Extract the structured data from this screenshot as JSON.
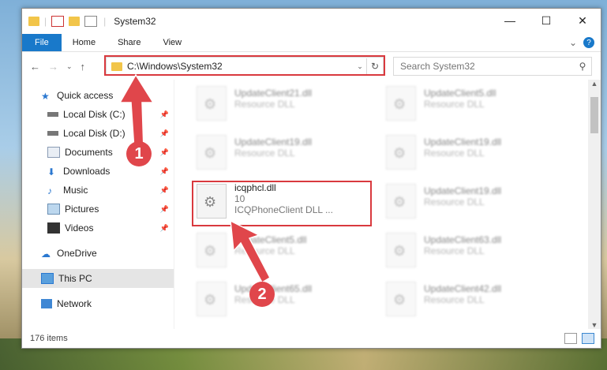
{
  "window": {
    "title": "System32",
    "controls": {
      "minimize": "—",
      "maximize": "☐",
      "close": "✕"
    }
  },
  "ribbon": {
    "tabs": [
      "File",
      "Home",
      "Share",
      "View"
    ],
    "expand": "⌄",
    "help": "?"
  },
  "address": {
    "path": "C:\\Windows\\System32",
    "dropdown": "⌄",
    "refresh": "↻"
  },
  "search": {
    "placeholder": "Search System32",
    "icon": "⚲"
  },
  "nav_buttons": {
    "back": "←",
    "forward": "→",
    "recent": "⌄",
    "up": "↑"
  },
  "sidebar": {
    "items": [
      {
        "label": "Quick access",
        "icon": "star-icon"
      },
      {
        "label": "Local Disk (C:)",
        "icon": "drive-icon",
        "pinned": true
      },
      {
        "label": "Local Disk (D:)",
        "icon": "drive-icon",
        "pinned": true
      },
      {
        "label": "Documents",
        "icon": "documents-icon",
        "pinned": true
      },
      {
        "label": "Downloads",
        "icon": "downloads-icon",
        "pinned": true
      },
      {
        "label": "Music",
        "icon": "music-icon",
        "pinned": true
      },
      {
        "label": "Pictures",
        "icon": "pictures-icon",
        "pinned": true
      },
      {
        "label": "Videos",
        "icon": "videos-icon",
        "pinned": true
      },
      {
        "label": "OneDrive",
        "icon": "cloud-icon"
      },
      {
        "label": "This PC",
        "icon": "computer-icon",
        "selected": true
      },
      {
        "label": "Network",
        "icon": "network-icon"
      }
    ]
  },
  "files": {
    "left": [
      {
        "name": "UpdateClient21.dll",
        "type": "Resource DLL"
      },
      {
        "name": "UpdateClient19.dll",
        "type": "Resource DLL"
      },
      {
        "name": "icqphcl.dll",
        "version": "10",
        "type": "ICQPhoneClient DLL ..."
      },
      {
        "name": "UpdateClient5.dll",
        "type": "Resource DLL"
      },
      {
        "name": "UpdateClient65.dll",
        "type": "Resource DLL"
      }
    ],
    "right": [
      {
        "name": "UpdateClient5.dll",
        "type": "Resource DLL"
      },
      {
        "name": "UpdateClient19.dll",
        "type": "Resource DLL"
      },
      {
        "name": "UpdateClient19.dll",
        "type": "Resource DLL"
      },
      {
        "name": "UpdateClient63.dll",
        "type": "Resource DLL"
      },
      {
        "name": "UpdateClient42.dll",
        "type": "Resource DLL"
      }
    ]
  },
  "status": {
    "item_count": "176 items"
  },
  "callouts": [
    "1",
    "2"
  ],
  "colors": {
    "accent": "#1979ca",
    "highlight": "#d9393e",
    "callout": "#e0464b"
  }
}
